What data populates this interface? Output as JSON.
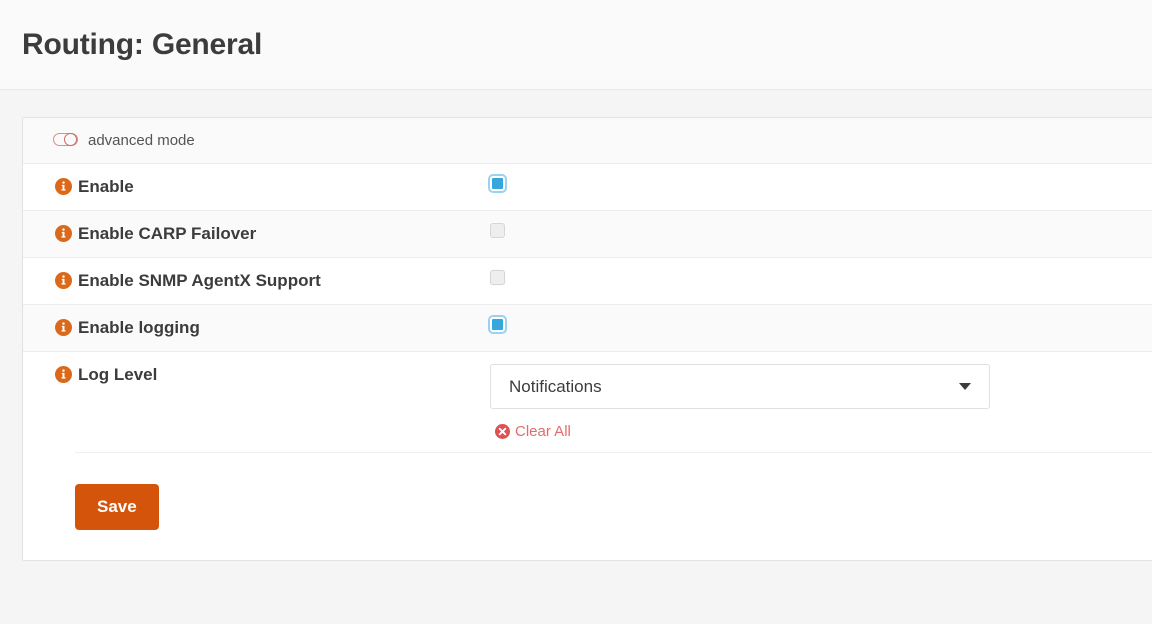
{
  "header": {
    "title": "Routing: General"
  },
  "advanced": {
    "label": "advanced mode",
    "icon": "toggle-off-icon",
    "enabled": false,
    "color": "#d06a6a"
  },
  "form": {
    "rows": [
      {
        "label": "Enable",
        "icon": "info-icon",
        "control": "checkbox",
        "checked": true
      },
      {
        "label": "Enable CARP Failover",
        "icon": "info-icon",
        "control": "checkbox",
        "checked": false
      },
      {
        "label": "Enable SNMP AgentX Support",
        "icon": "info-icon",
        "control": "checkbox",
        "checked": false
      },
      {
        "label": "Enable logging",
        "icon": "info-icon",
        "control": "checkbox",
        "checked": true
      },
      {
        "label": "Log Level",
        "icon": "info-icon",
        "control": "select",
        "value": "Notifications",
        "clear_label": "Clear All",
        "clear_icon": "circle-x-icon"
      }
    ]
  },
  "footer": {
    "save_label": "Save"
  },
  "colors": {
    "accent_orange": "#d4540c",
    "info_orange": "#da6a19",
    "checkbox_blue": "#35a7dd",
    "danger_red": "#e05252",
    "toggle_red": "#d06a6a"
  }
}
